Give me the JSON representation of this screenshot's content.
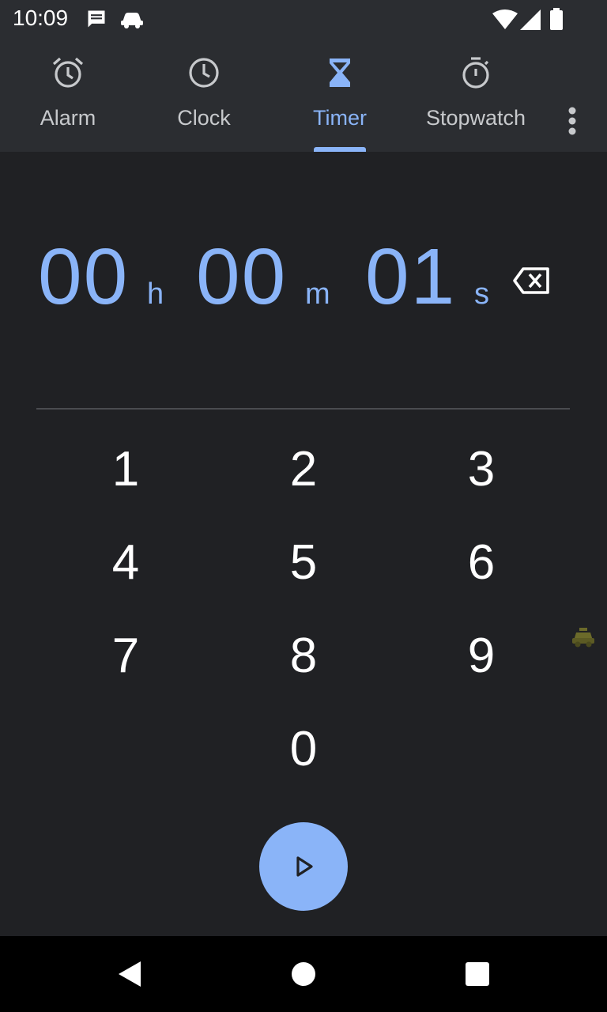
{
  "status": {
    "time": "10:09"
  },
  "tabs": [
    {
      "label": "Alarm",
      "icon": "alarm-icon"
    },
    {
      "label": "Clock",
      "icon": "clock-icon"
    },
    {
      "label": "Timer",
      "icon": "hourglass-icon",
      "active": true
    },
    {
      "label": "Stopwatch",
      "icon": "stopwatch-icon"
    }
  ],
  "timer": {
    "hours": "00",
    "hours_unit": "h",
    "minutes": "00",
    "minutes_unit": "m",
    "seconds": "01",
    "seconds_unit": "s"
  },
  "keypad": [
    "1",
    "2",
    "3",
    "4",
    "5",
    "6",
    "7",
    "8",
    "9",
    "0"
  ],
  "colors": {
    "accent": "#8ab4f8",
    "background": "#202124",
    "appbar": "#2b2d31"
  }
}
